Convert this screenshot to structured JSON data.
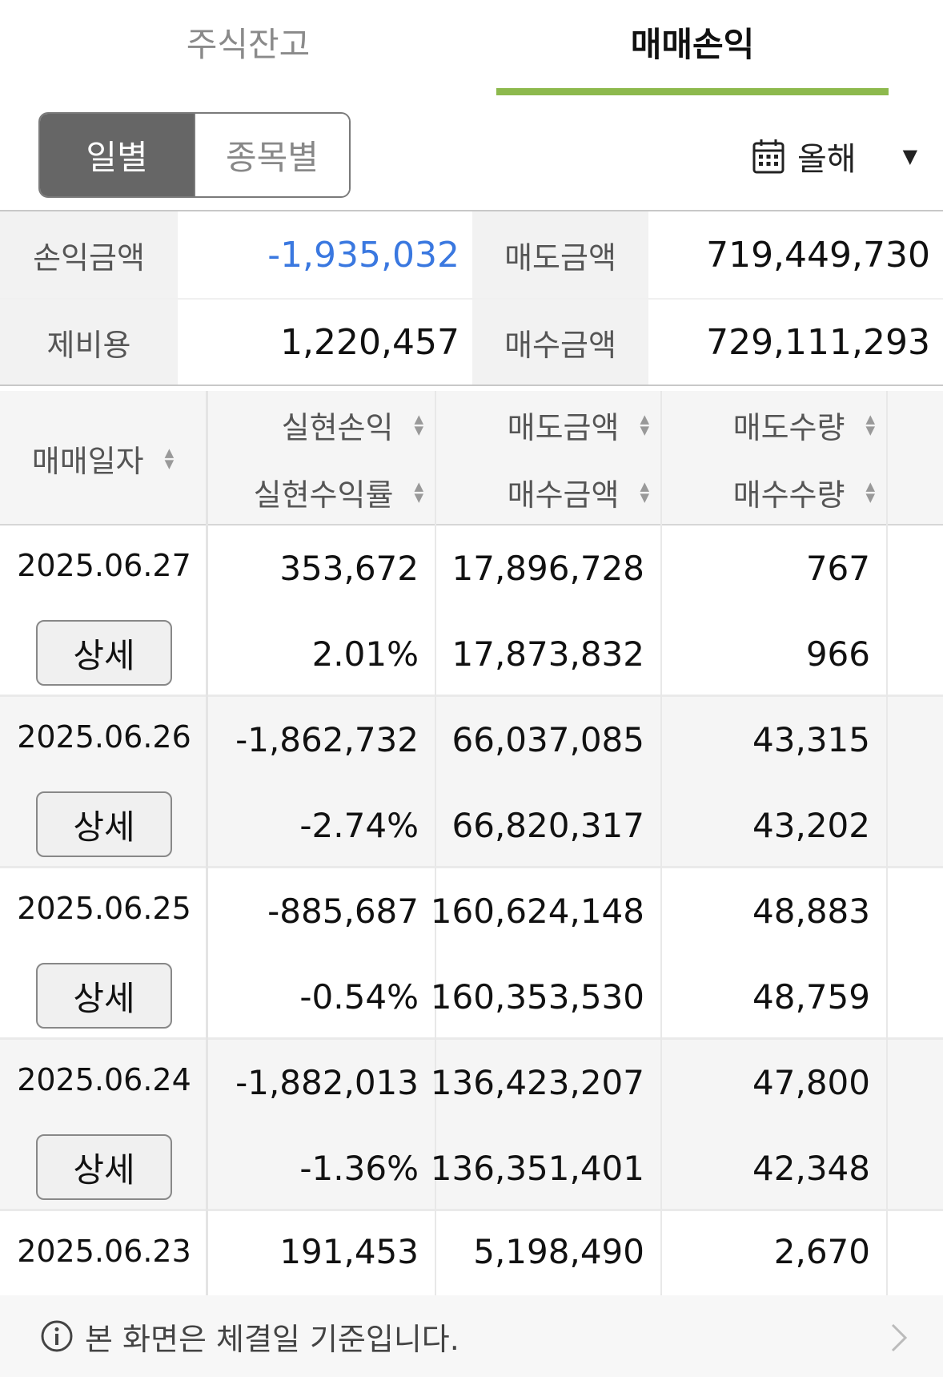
{
  "tabs": {
    "stock_balance": "주식잔고",
    "trade_pnl": "매매손익"
  },
  "segment": {
    "daily": "일별",
    "by_item": "종목별"
  },
  "period": {
    "label": "올해",
    "icon": "calendar-icon",
    "dropdown_icon": "caret-down-icon"
  },
  "summary": {
    "pnl_label": "손익금액",
    "pnl_value": "-1,935,032",
    "sell_label": "매도금액",
    "sell_value": "719,449,730",
    "fee_label": "제비용",
    "fee_value": "1,220,457",
    "buy_label": "매수금액",
    "buy_value": "729,111,293"
  },
  "table": {
    "headers": {
      "date": "매매일자",
      "realized_pnl": "실현손익",
      "realized_rate": "실현수익률",
      "sell_amount": "매도금액",
      "buy_amount": "매수금액",
      "sell_qty": "매도수량",
      "buy_qty": "매수수량"
    },
    "detail_label": "상세",
    "rows": [
      {
        "date": "2025.06.27",
        "pnl": "353,672",
        "rate": "2.01%",
        "sell_amt": "17,896,728",
        "buy_amt": "17,873,832",
        "sell_qty": "767",
        "buy_qty": "966",
        "sign": "positive"
      },
      {
        "date": "2025.06.26",
        "pnl": "-1,862,732",
        "rate": "-2.74%",
        "sell_amt": "66,037,085",
        "buy_amt": "66,820,317",
        "sell_qty": "43,315",
        "buy_qty": "43,202",
        "sign": "negative"
      },
      {
        "date": "2025.06.25",
        "pnl": "-885,687",
        "rate": "-0.54%",
        "sell_amt": "160,624,148",
        "buy_amt": "160,353,530",
        "sell_qty": "48,883",
        "buy_qty": "48,759",
        "sign": "negative"
      },
      {
        "date": "2025.06.24",
        "pnl": "-1,882,013",
        "rate": "-1.36%",
        "sell_amt": "136,423,207",
        "buy_amt": "136,351,401",
        "sell_qty": "47,800",
        "buy_qty": "42,348",
        "sign": "negative"
      },
      {
        "date": "2025.06.23",
        "pnl": "191,453",
        "rate": "",
        "sell_amt": "5,198,490",
        "buy_amt": "",
        "sell_qty": "2,670",
        "buy_qty": "",
        "sign": "positive"
      }
    ]
  },
  "footer": {
    "notice": "본 화면은 체결일 기준입니다.",
    "icon": "info-icon"
  },
  "colors": {
    "accent": "#8db94d",
    "positive": "#d83a2e",
    "negative": "#3a78e0",
    "segment_active": "#666666"
  }
}
